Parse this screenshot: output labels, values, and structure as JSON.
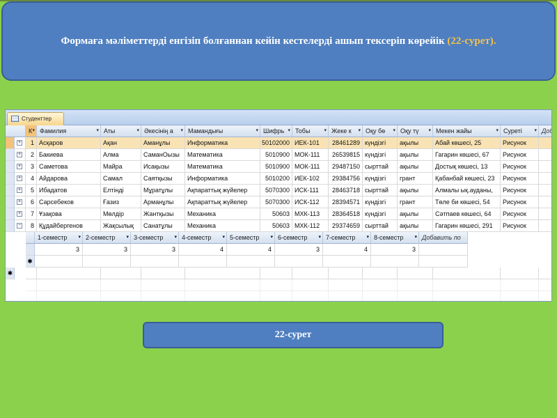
{
  "slide": {
    "title_main": "Формаға мәліметтерді енгізіп болғаннан кейін кестелерді ашып тексеріп көрейік",
    "title_ref": "(22-сурет).",
    "caption": "22-сурет"
  },
  "window": {
    "tab_label": "Студенттер"
  },
  "table": {
    "columns": [
      "К",
      "Фамилия",
      "Аты",
      "Әкесінің а",
      "Мамандығы",
      "Шифрь",
      "Тобы",
      "Жеке к",
      "Оқу бө",
      "Оқу тү",
      "Мекен жайы",
      "Суреті",
      "Добав"
    ],
    "rows": [
      [
        "1",
        "Асқаров",
        "Ақан",
        "Аманұлы",
        "Информатика",
        "50102000",
        "ИЕК-101",
        "28461289",
        "күндізгі",
        "ақылы",
        "Абай көшесі, 25",
        "Рисунок"
      ],
      [
        "2",
        "Бакиева",
        "Алма",
        "СаманОызы",
        "Математика",
        "5010900",
        "МОК-111",
        "26539815",
        "күндізгі",
        "ақылы",
        "Гагарин көшесі, 67",
        "Рисунок"
      ],
      [
        "3",
        "Саметова",
        "Майра",
        "Исақызы",
        "Математика",
        "5010900",
        "МОК-111",
        "29487150",
        "сырттай",
        "ақылы",
        "Достық көшесі, 13",
        "Рисунок"
      ],
      [
        "4",
        "Айдарова",
        "Самал",
        "Саятқызы",
        "Информатика",
        "5010200",
        "ИЕК-102",
        "29384756",
        "күндізгі",
        "грант",
        "Қабанбай көшесі, 23",
        "Рисунок"
      ],
      [
        "5",
        "Ибадатов",
        "Елтінді",
        "Мұратұлы",
        "Ақпараттық жүйелер",
        "5070300",
        "ИСК-111",
        "28463718",
        "сырттай",
        "ақылы",
        "Алмалы ық.ауданы,",
        "Рисунок"
      ],
      [
        "6",
        "Сарсебеков",
        "Ғазиз",
        "Арманұлы",
        "Ақпараттық жүйелер",
        "5070300",
        "ИСК-112",
        "28394571",
        "күндізгі",
        "грант",
        "Төле би көшесі, 54",
        "Рисунок"
      ],
      [
        "7",
        "Ұзақова",
        "Мөлдір",
        "Жантқызы",
        "Механика",
        "50603",
        "МХК-113",
        "28364518",
        "күндізгі",
        "ақылы",
        "Сәтпаев көшесі, 64",
        "Рисунок"
      ],
      [
        "8",
        "Құдайбергенов",
        "Жақсылық",
        "Санатұлы",
        "Механика",
        "50603",
        "МХК-112",
        "29374659",
        "сырттай",
        "ақылы",
        "Гагарин көшесі, 291",
        "Рисунок"
      ]
    ],
    "subtable": {
      "columns": [
        "1-семестр",
        "2-семестр",
        "3-семестр",
        "4-семестр",
        "5-семестр",
        "6-семестр",
        "7-семестр",
        "8-семестр",
        "Добавить по"
      ],
      "values": [
        "3",
        "3",
        "3",
        "4",
        "4",
        "3",
        "4",
        "3"
      ]
    },
    "new_row_marker": "✱"
  },
  "icons": {
    "expand_plus": "+",
    "expand_minus": "−",
    "dropdown": "▾"
  },
  "colors": {
    "slide_bg": "#8cd14c",
    "title_box": "#4f7fc0",
    "title_ref": "#f5c24a",
    "selected_cell": "#f9e3b4"
  }
}
